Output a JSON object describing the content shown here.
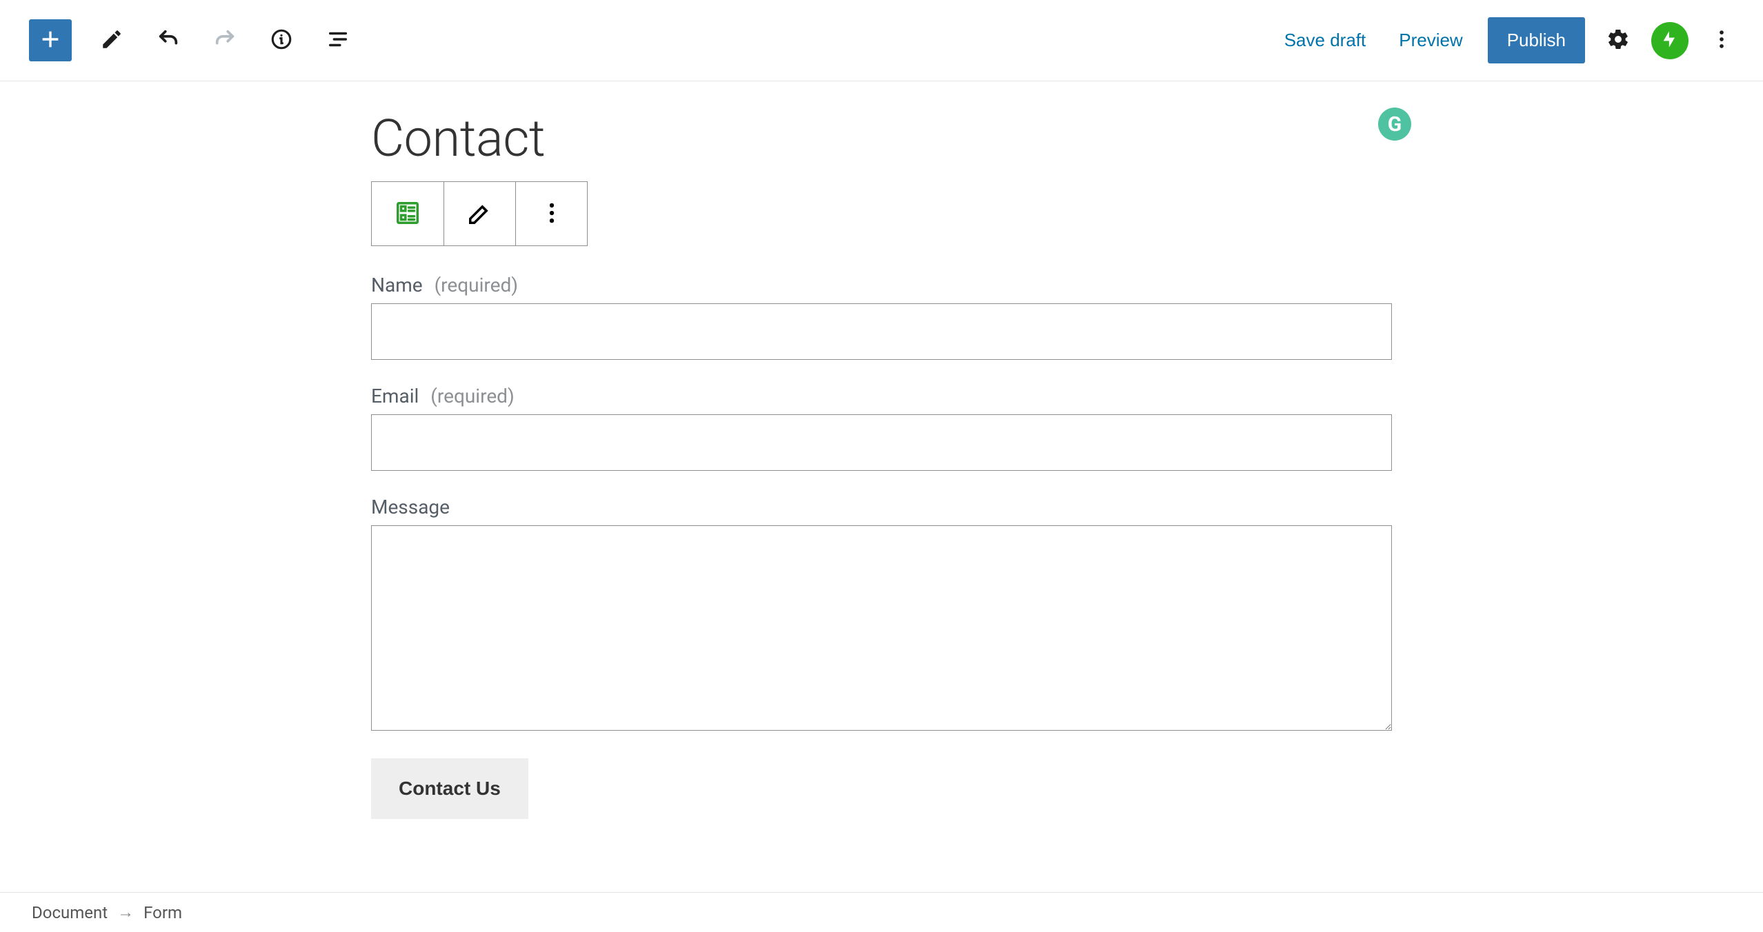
{
  "toolbar": {
    "save_draft": "Save draft",
    "preview": "Preview",
    "publish": "Publish"
  },
  "page": {
    "title": "Contact"
  },
  "form": {
    "fields": [
      {
        "label": "Name",
        "required_text": "(required)",
        "required": true,
        "type": "text",
        "value": ""
      },
      {
        "label": "Email",
        "required_text": "(required)",
        "required": true,
        "type": "text",
        "value": ""
      },
      {
        "label": "Message",
        "required_text": "",
        "required": false,
        "type": "textarea",
        "value": ""
      }
    ],
    "submit_label": "Contact Us"
  },
  "grammarly": {
    "letter": "G"
  },
  "breadcrumb": {
    "root": "Document",
    "current": "Form",
    "separator": "→"
  }
}
